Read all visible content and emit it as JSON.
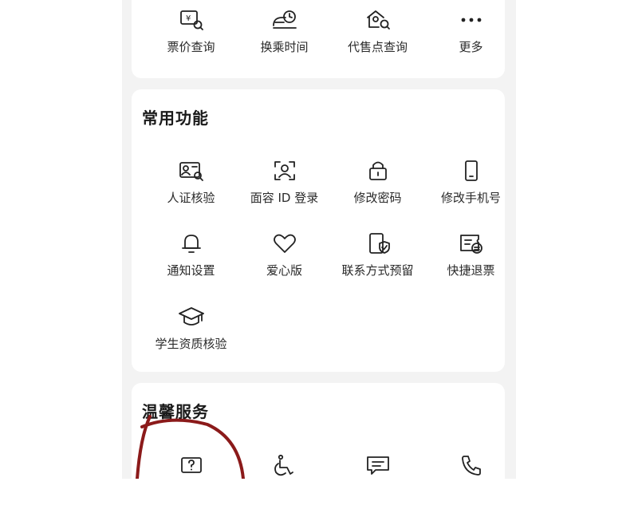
{
  "top_row": [
    {
      "label": "票价查询",
      "icon": "fare-search-icon"
    },
    {
      "label": "换乘时间",
      "icon": "transfer-time-icon"
    },
    {
      "label": "代售点查询",
      "icon": "agency-search-icon"
    },
    {
      "label": "更多",
      "icon": "more-icon"
    }
  ],
  "common": {
    "title": "常用功能",
    "items": [
      {
        "label": "人证核验",
        "icon": "id-verify-icon"
      },
      {
        "label": "面容 ID 登录",
        "icon": "face-id-icon"
      },
      {
        "label": "修改密码",
        "icon": "lock-icon"
      },
      {
        "label": "修改手机号",
        "icon": "phone-icon"
      },
      {
        "label": "通知设置",
        "icon": "bell-icon"
      },
      {
        "label": "爱心版",
        "icon": "heart-icon"
      },
      {
        "label": "联系方式预留",
        "icon": "contact-shield-icon"
      },
      {
        "label": "快捷退票",
        "icon": "ticket-refund-icon"
      },
      {
        "label": "学生资质核验",
        "icon": "graduation-cap-icon"
      }
    ]
  },
  "warm": {
    "title": "温馨服务",
    "items": [
      {
        "icon": "help-question-icon"
      },
      {
        "icon": "wheelchair-icon"
      },
      {
        "icon": "message-icon"
      },
      {
        "icon": "phone-call-icon"
      }
    ]
  },
  "colors": {
    "background": "#f3f3f3",
    "card": "#ffffff",
    "annotation": "#8b1a1a"
  }
}
